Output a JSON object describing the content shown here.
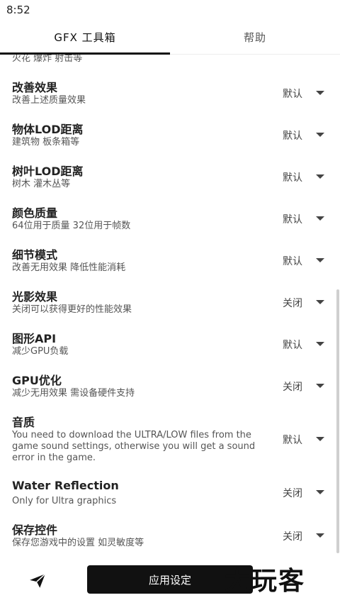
{
  "status": {
    "time": "8:52"
  },
  "tabs": [
    {
      "label": "GFX 工具箱"
    },
    {
      "label": "帮助"
    }
  ],
  "cutoff_subtitle": "火花 爆炸 射击等",
  "settings": [
    {
      "title": "改善效果",
      "subtitle": "改善上述质量效果",
      "value": "默认"
    },
    {
      "title": "物体LOD距离",
      "subtitle": "建筑物 板条箱等",
      "value": "默认"
    },
    {
      "title": "树叶LOD距离",
      "subtitle": "树木 灌木丛等",
      "value": "默认"
    },
    {
      "title": "颜色质量",
      "subtitle": "64位用于质量 32位用于帧数",
      "value": "默认"
    },
    {
      "title": "细节模式",
      "subtitle": "改善无用效果 降低性能消耗",
      "value": "默认"
    },
    {
      "title": "光影效果",
      "subtitle": "关闭可以获得更好的性能效果",
      "value": "关闭"
    },
    {
      "title": "图形API",
      "subtitle": "减少GPU负载",
      "value": "默认"
    },
    {
      "title": "GPU优化",
      "subtitle": "减少无用效果 需设备硬件支持",
      "value": "关闭"
    },
    {
      "title": "音质",
      "subtitle": "You need to download the ULTRA/LOW files from the game sound settings, otherwise you will get a sound error in the game.",
      "value": "默认"
    },
    {
      "title": "Water Reflection",
      "subtitle": "Only for Ultra graphics",
      "value": "关闭"
    },
    {
      "title": "保存控件",
      "subtitle": "保存您游戏中的设置 如灵敏度等",
      "value": "关闭"
    }
  ],
  "bottom": {
    "apply_label": "应用设定",
    "watermark": "大玩客"
  }
}
